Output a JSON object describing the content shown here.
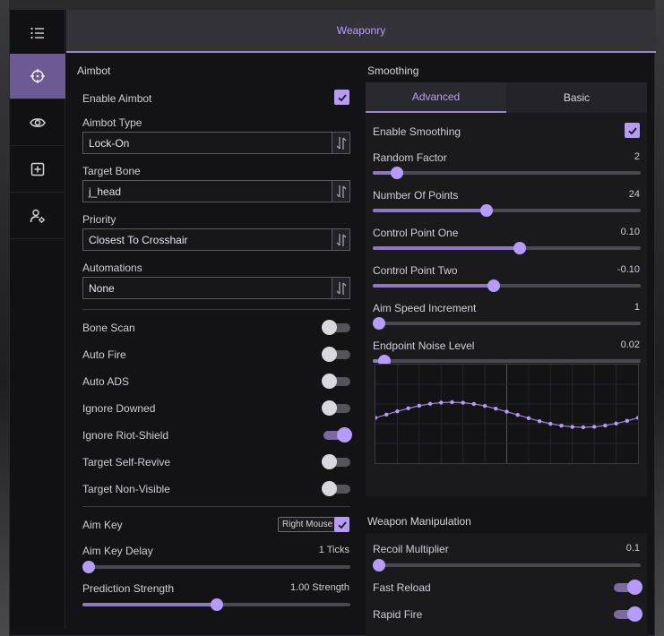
{
  "header": {
    "title": "Weaponry"
  },
  "sidebar": {
    "items": [
      {
        "name": "menu-icon",
        "active": false
      },
      {
        "name": "crosshair-icon",
        "active": true
      },
      {
        "name": "eye-icon",
        "active": false
      },
      {
        "name": "plus-square-icon",
        "active": false
      },
      {
        "name": "user-gear-icon",
        "active": false
      }
    ]
  },
  "aimbot": {
    "title": "Aimbot",
    "enable_label": "Enable Aimbot",
    "enable_checked": true,
    "type_label": "Aimbot Type",
    "type_value": "Lock-On",
    "bone_label": "Target Bone",
    "bone_value": "j_head",
    "priority_label": "Priority",
    "priority_value": "Closest To Crosshair",
    "automations_label": "Automations",
    "automations_value": "None",
    "toggles": [
      {
        "label": "Bone Scan",
        "on": false
      },
      {
        "label": "Auto Fire",
        "on": false
      },
      {
        "label": "Auto ADS",
        "on": false
      },
      {
        "label": "Ignore Downed",
        "on": false
      },
      {
        "label": "Ignore Riot-Shield",
        "on": true
      },
      {
        "label": "Target Self-Revive",
        "on": false
      },
      {
        "label": "Target Non-Visible",
        "on": false
      }
    ],
    "aim_key_label": "Aim Key",
    "aim_key_value": "Right Mouse",
    "aim_key_checked": true,
    "aim_key_delay_label": "Aim Key Delay",
    "aim_key_delay_value": "1 Ticks",
    "aim_key_delay_fraction": 0.0,
    "prediction_label": "Prediction Strength",
    "prediction_value": "1.00 Strength",
    "prediction_fraction": 0.5
  },
  "smoothing": {
    "title": "Smoothing",
    "tabs": [
      {
        "label": "Advanced",
        "active": true
      },
      {
        "label": "Basic",
        "active": false
      }
    ],
    "enable_label": "Enable Smoothing",
    "enable_checked": true,
    "sliders": [
      {
        "label": "Random Factor",
        "value": "2",
        "fraction": 0.07
      },
      {
        "label": "Number Of Points",
        "value": "24",
        "fraction": 0.42
      },
      {
        "label": "Control Point One",
        "value": "0.10",
        "fraction": 0.55
      },
      {
        "label": "Control Point Two",
        "value": "-0.10",
        "fraction": 0.45
      },
      {
        "label": "Aim Speed Increment",
        "value": "1",
        "fraction": 0.0
      },
      {
        "label": "Endpoint Noise Level",
        "value": "0.02",
        "fraction": 0.02
      }
    ]
  },
  "weapon": {
    "title": "Weapon Manipulation",
    "recoil_label": "Recoil Multiplier",
    "recoil_value": "0.1",
    "recoil_fraction": 0.0,
    "fast_reload_label": "Fast Reload",
    "fast_reload_on": true,
    "rapid_fire_label": "Rapid Fire",
    "rapid_fire_on": true
  },
  "colors": {
    "accent": "#b69bff",
    "header_text": "#b89eff",
    "active_sidebar": "#6c5a94"
  }
}
